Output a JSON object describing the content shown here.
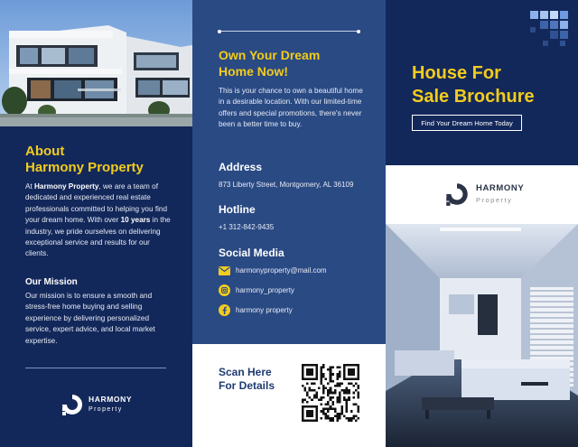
{
  "colors": {
    "navy": "#13285a",
    "mid_blue": "#2a4a84",
    "accent_yellow": "#f2cc1d",
    "white": "#ffffff"
  },
  "about": {
    "heading_line1": "About",
    "heading_line2": "Harmony Property",
    "text_pre": "At ",
    "text_bold_company": "Harmony Property",
    "text_mid": ", we are a team of dedicated and experienced real estate professionals committed to helping you find your dream home. With over ",
    "text_bold_years": "10 years",
    "text_post": " in the industry, we pride ourselves on delivering exceptional service and results for our clients."
  },
  "mission": {
    "heading": "Our Mission",
    "text": "Our mission is to ensure a smooth and stress-free home buying and selling experience by delivering personalized service, expert advice, and local market expertise."
  },
  "logo": {
    "name": "HARMONY",
    "sub": "Property",
    "sub_alt": "Property",
    "icon": "harmony-logo-icon"
  },
  "promo": {
    "heading_line1": "Own Your Dream",
    "heading_line2": "Home Now!",
    "text": "This is your chance to own a beautiful home in a desirable location. With our limited-time offers and special promotions, there's never been a better time to buy."
  },
  "address": {
    "heading": "Address",
    "value": "873 Liberty Street, Montgomery, AL 36109"
  },
  "hotline": {
    "heading": "Hotline",
    "value": "+1 312-842-9435"
  },
  "social": {
    "heading": "Social Media",
    "items": [
      {
        "icon": "email-icon",
        "label": "harmonyproperty@mail.com"
      },
      {
        "icon": "instagram-icon",
        "label": "harmony_property"
      },
      {
        "icon": "facebook-icon",
        "label": "harmony property"
      }
    ]
  },
  "scan": {
    "line1": "Scan Here",
    "line2": "For Details",
    "icon": "qr-code-icon"
  },
  "cover": {
    "title_line1": "House For",
    "title_line2": "Sale Brochure",
    "button": "Find Your Dream Home Today"
  }
}
